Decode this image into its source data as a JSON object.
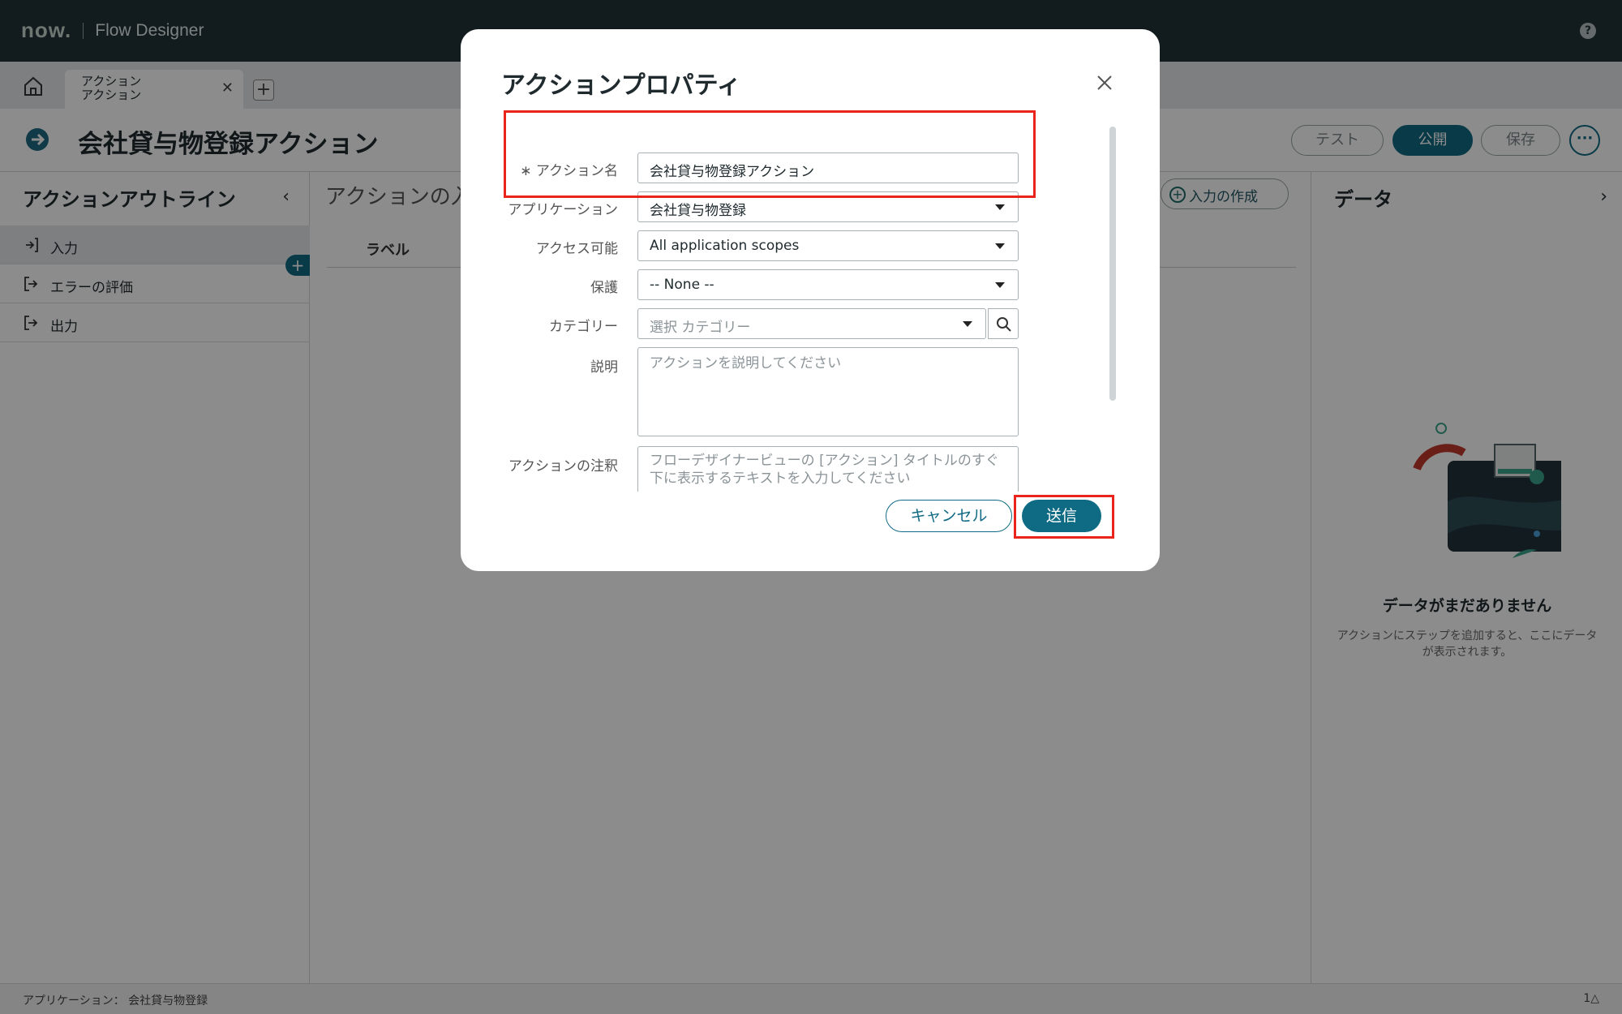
{
  "topbar": {
    "logo": "now.",
    "app_name": "Flow Designer",
    "help_glyph": "?"
  },
  "tabs": [
    {
      "line1": "アクション",
      "line2": "アクション"
    }
  ],
  "header": {
    "title": "会社貸与物登録アクション",
    "buttons": {
      "test": "テスト",
      "publish": "公開",
      "save": "保存",
      "more": "···"
    }
  },
  "sidebar": {
    "title": "アクションアウトライン",
    "items": [
      {
        "label": "入力"
      },
      {
        "label": "エラーの評価"
      },
      {
        "label": "出力"
      }
    ]
  },
  "center": {
    "title": "アクションの入力",
    "create_input": "入力の作成",
    "col_label": "ラベル"
  },
  "data_panel": {
    "title": "データ",
    "empty_title": "データがまだありません",
    "empty_desc": "アクションにステップを追加すると、ここにデータが表示されます。"
  },
  "footer": {
    "app_label": "アプリケーション： 会社貸与物登録",
    "notif": "1△"
  },
  "modal": {
    "title": "アクションプロパティ",
    "fields": {
      "action_name": {
        "label": "アクション名",
        "required_mark": "∗",
        "value": "会社貸与物登録アクション"
      },
      "application": {
        "label": "アプリケーション",
        "value": "会社貸与物登録"
      },
      "accessible": {
        "label": "アクセス可能",
        "value": "All application scopes"
      },
      "protection": {
        "label": "保護",
        "value": "-- None --"
      },
      "category": {
        "label": "カテゴリー",
        "placeholder": "選択 カテゴリー"
      },
      "description": {
        "label": "説明",
        "placeholder": "アクションを説明してください"
      },
      "annotation": {
        "label": "アクションの注釈",
        "placeholder": "フローデザイナービューの [アクション] タイトルのすぐ下に表示するテキストを入力してください"
      }
    },
    "buttons": {
      "cancel": "キャンセル",
      "submit": "送信"
    }
  },
  "colors": {
    "accent": "#0f6a84",
    "topbar": "#223237",
    "highlight": "#e8241b"
  }
}
